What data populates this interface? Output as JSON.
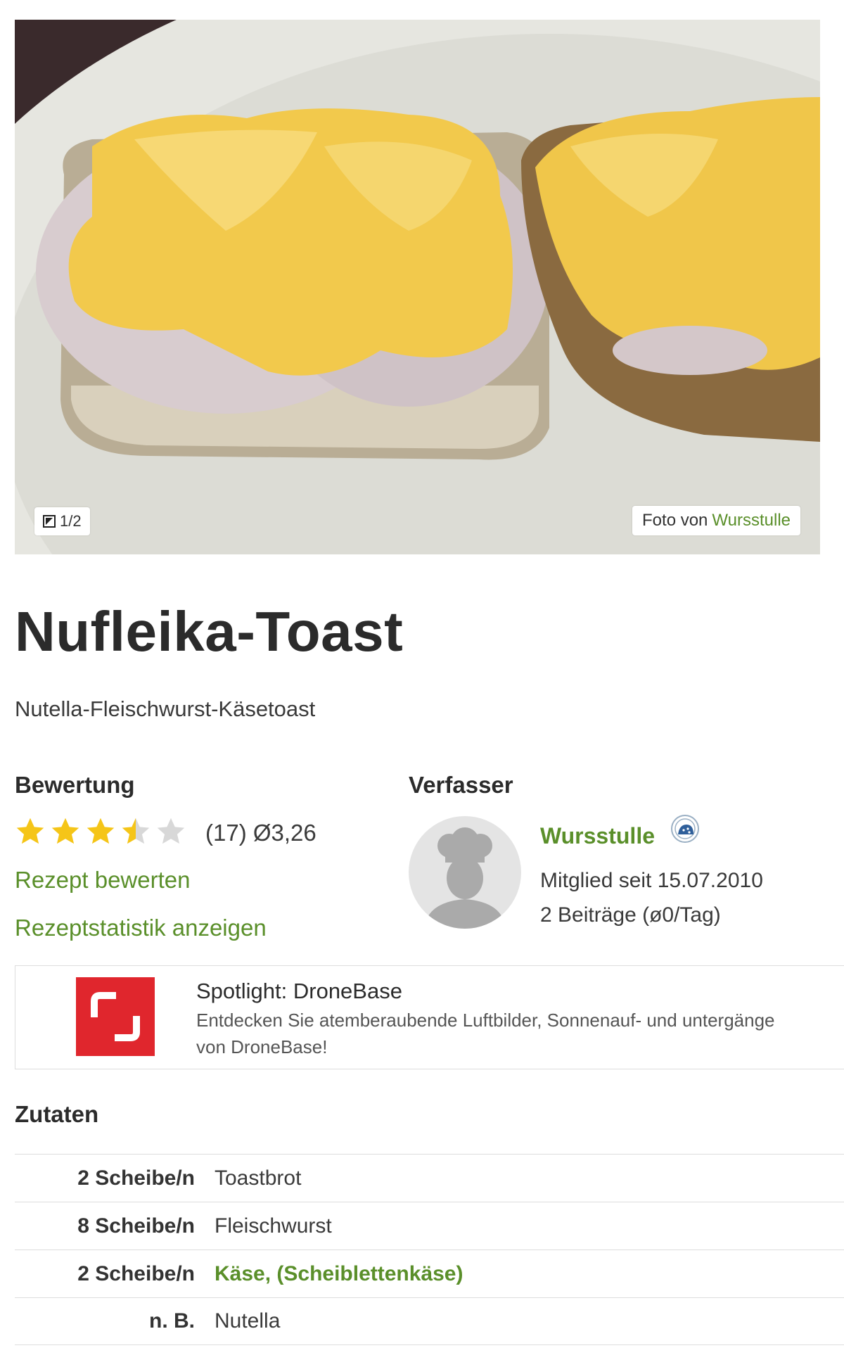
{
  "hero": {
    "pager": "1/2",
    "credit_prefix": "Foto von",
    "credit_author": "Wursstulle"
  },
  "recipe": {
    "title": "Nufleika-Toast",
    "subtitle": "Nutella-Fleischwurst-Käsetoast"
  },
  "rating": {
    "heading": "Bewertung",
    "stars": 3.26,
    "count_text": "(17)",
    "average_text": "Ø3,26",
    "rate_link": "Rezept bewerten",
    "stats_link": "Rezeptstatistik anzeigen",
    "star_color": "#f5c518",
    "star_empty_color": "#d8d8d8"
  },
  "author": {
    "heading": "Verfasser",
    "name": "Wursstulle",
    "member_since": "Mitglied seit 15.07.2010",
    "posts": "2 Beiträge (ø0/Tag)",
    "badge_icon": "chef-badge-icon",
    "avatar_icon": "chef-avatar-icon"
  },
  "spotlight": {
    "title": "Spotlight: DroneBase",
    "text": "Entdecken Sie atemberaubende Luftbilder, Sonnenauf- und untergänge von DroneBase!",
    "logo_color": "#e0262d"
  },
  "ingredients": {
    "heading": "Zutaten",
    "items": [
      {
        "amount": "2 Scheibe/n",
        "name": "Toastbrot",
        "link": false
      },
      {
        "amount": "8 Scheibe/n",
        "name": "Fleischwurst",
        "link": false
      },
      {
        "amount": "2 Scheibe/n",
        "name": "Käse, (Scheiblettenkäse)",
        "link": true
      },
      {
        "amount": "n. B.",
        "name": "Nutella",
        "link": false
      }
    ]
  },
  "colors": {
    "link_green": "#5a8f2a",
    "text_dark": "#2b2b2b"
  }
}
